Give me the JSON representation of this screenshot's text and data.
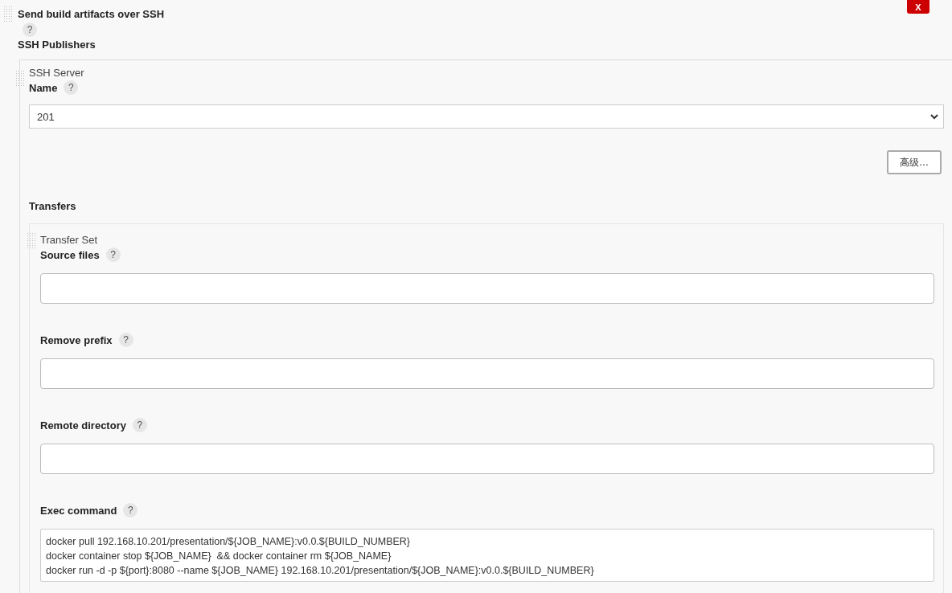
{
  "section": {
    "title": "Send build artifacts over SSH",
    "delete_button": "X",
    "help": "?",
    "subtitle": "SSH Publishers"
  },
  "ssh_server": {
    "title": "SSH Server",
    "name_label": "Name",
    "name_help": "?",
    "name_value": "201",
    "advanced_button": "高级...",
    "transfers_label": "Transfers"
  },
  "transfer_set": {
    "title": "Transfer Set",
    "fields": [
      {
        "kind": "input",
        "label": "Source files",
        "help": "?"
      },
      {
        "kind": "input",
        "label": "Remove prefix",
        "help": "?"
      },
      {
        "kind": "input",
        "label": "Remote directory",
        "help": "?"
      },
      {
        "kind": "textarea",
        "label": "Exec command",
        "help": "?",
        "value": "docker pull 192.168.10.201/presentation/${JOB_NAME}:v0.0.${BUILD_NUMBER}\ndocker container stop ${JOB_NAME}  && docker container rm ${JOB_NAME}\ndocker run -d -p ${port}:8080 --name ${JOB_NAME} 192.168.10.201/presentation/${JOB_NAME}:v0.0.${BUILD_NUMBER}"
      }
    ]
  }
}
